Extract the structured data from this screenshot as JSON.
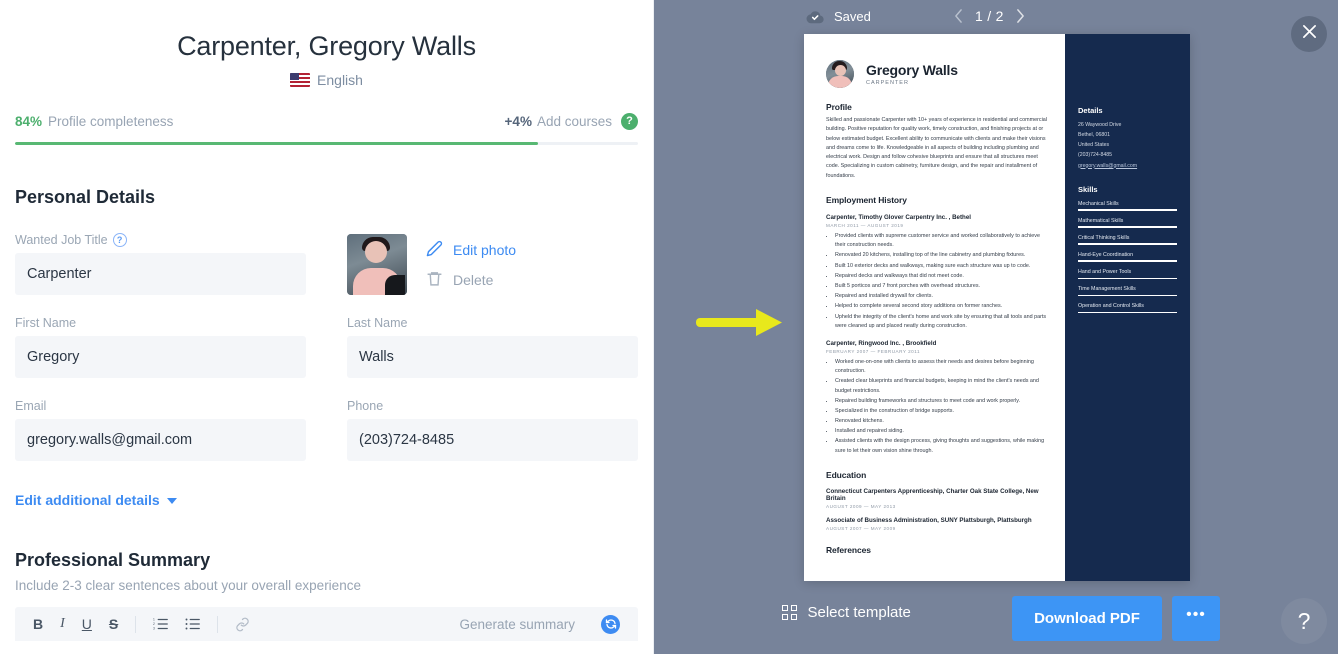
{
  "editor": {
    "title": "Carpenter, Gregory Walls",
    "language": "English",
    "flag_icon": "us-flag-icon",
    "progress": {
      "percent_label": "84%",
      "percent_value": 84,
      "completeness_label": "Profile completeness",
      "add_percent_label": "+4%",
      "add_label": "Add courses",
      "help_glyph": "?",
      "fill_color": "#58b873"
    },
    "personal_details": {
      "heading": "Personal Details",
      "wanted_job_title": {
        "label": "Wanted Job Title",
        "value": "Carpenter",
        "help_glyph": "?"
      },
      "first_name": {
        "label": "First Name",
        "value": "Gregory"
      },
      "last_name": {
        "label": "Last Name",
        "value": "Walls"
      },
      "email": {
        "label": "Email",
        "value": "gregory.walls@gmail.com"
      },
      "phone": {
        "label": "Phone",
        "value": "(203)724-8485"
      },
      "photo": {
        "edit_label": "Edit photo",
        "delete_label": "Delete",
        "edit_icon": "pencil-icon",
        "delete_icon": "trash-icon"
      }
    },
    "additional_details_link": "Edit additional details",
    "professional_summary": {
      "heading": "Professional Summary",
      "hint": "Include 2-3 clear sentences about your overall experience",
      "toolbar": {
        "bold": "B",
        "italic": "I",
        "underline": "U",
        "strike": "S",
        "ordered_list_icon": "ordered-list-icon",
        "bullet_list_icon": "bullet-list-icon",
        "link_icon": "link-icon",
        "generate_label": "Generate summary",
        "generate_icon": "refresh-icon"
      }
    }
  },
  "preview": {
    "saved_label": "Saved",
    "saved_icon": "cloud-check-icon",
    "page_indicator": "1 / 2",
    "prev_icon": "chevron-left-icon",
    "next_icon": "chevron-right-icon",
    "close_icon": "close-icon",
    "select_template_label": "Select template",
    "select_template_icon": "grid-icon",
    "download_label": "Download PDF",
    "more_label": "•••",
    "help_label": "?",
    "accent_color": "#3d95f5",
    "backdrop_color": "#77839a",
    "annotation": {
      "type": "arrow",
      "color": "#e8e81c",
      "direction": "right"
    }
  },
  "resume": {
    "name": "Gregory Walls",
    "role": "CARPENTER",
    "profile": {
      "heading": "Profile",
      "text": "Skilled and passionate Carpenter with 10+ years of experience in residential and commercial building. Positive reputation for quality work, timely construction, and finishing projects at or below estimated budget. Excellent ability to communicate with clients and make their visions and dreams come to life. Knowledgeable in all aspects of building including plumbing and electrical work. Design and follow cohesive blueprints and ensure that all structures meet code. Specializing in custom cabinetry, furniture design, and the repair and installment of foundations."
    },
    "employment": {
      "heading": "Employment History",
      "jobs": [
        {
          "title": "Carpenter, Timothy Glover Carpentry Inc. , Bethel",
          "dates": "MARCH 2011 — AUGUST 2019",
          "bullets": [
            "Provided clients with supreme customer service and worked collaboratively to achieve their construction needs.",
            "Renovated 20 kitchens, installing top of the line cabinetry and plumbing fixtures.",
            "Built 10 exterior decks and walkways, making sure each structure was up to code.",
            "Repaired decks and walkways that did not meet code.",
            "Built 5 porticos and 7 front porches with overhead structures.",
            "Repaired and installed drywall for clients.",
            "Helped to complete several second story additions on former ranches.",
            "Upheld the integrity of the client's home and work site by ensuring that all tools and parts were cleaned up and placed neatly during construction."
          ]
        },
        {
          "title": "Carpenter, Ringwood Inc. , Brookfield",
          "dates": "FEBRUARY 2007 — FEBRUARY 2011",
          "bullets": [
            "Worked one-on-one with clients to assess their needs and desires before beginning construction.",
            "Created clear blueprints and financial budgets, keeping in mind the client's needs and budget restrictions.",
            "Repaired building frameworks and structures to meet code and work properly.",
            "Specialized in the construction of bridge supports.",
            "Renovated kitchens.",
            "Installed and repaired siding.",
            "Assisted clients with the design process, giving thoughts and suggestions, while making sure to let their own vision shine through."
          ]
        }
      ]
    },
    "education": {
      "heading": "Education",
      "entries": [
        {
          "title": "Connecticut Carpenters Apprenticeship, Charter Oak State College, New Britain",
          "dates": "AUGUST 2009 — MAY 2013"
        },
        {
          "title": "Associate of Business Administration, SUNY Plattsburgh, Plattsburgh",
          "dates": "AUGUST 2007 — MAY 2009"
        }
      ]
    },
    "references_heading": "References",
    "details": {
      "heading": "Details",
      "lines": [
        "26 Waywood Drive",
        "Bethel, 06801",
        "United States",
        "(203)724-8485"
      ],
      "email": "gregory.walls@gmail.com"
    },
    "skills": {
      "heading": "Skills",
      "items": [
        {
          "name": "Mechanical Skills",
          "level": 100
        },
        {
          "name": "Mathematical Skills",
          "level": 100
        },
        {
          "name": "Critical Thinking Skills",
          "level": 100
        },
        {
          "name": "Hand-Eye Coordination",
          "level": 100
        },
        {
          "name": "Hand and Power Tools",
          "level": 100
        },
        {
          "name": "Time Management Skills",
          "level": 100
        },
        {
          "name": "Operation and Control Skills",
          "level": 100
        }
      ]
    },
    "sidebar_color": "#152a4e"
  }
}
